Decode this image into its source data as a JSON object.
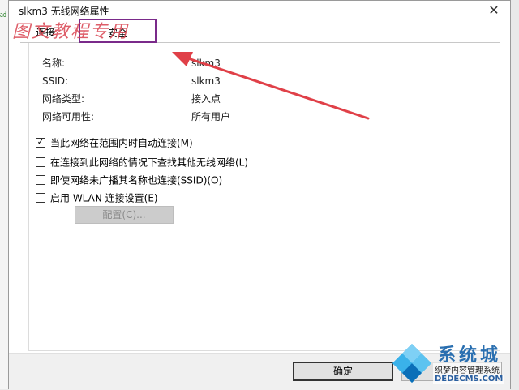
{
  "window": {
    "title": "slkm3 无线网络属性",
    "close_glyph": "✕"
  },
  "behind_window_fragment": "ad",
  "tabs": [
    {
      "label": "连接",
      "selected": false
    },
    {
      "label": "安全",
      "selected": true
    }
  ],
  "watermark_text": "图文教程专用",
  "properties": [
    {
      "label": "名称:",
      "value": "slkm3"
    },
    {
      "label": "SSID:",
      "value": "slkm3"
    },
    {
      "label": "网络类型:",
      "value": "接入点"
    },
    {
      "label": "网络可用性:",
      "value": "所有用户"
    }
  ],
  "options": [
    {
      "label": "当此网络在范围内时自动连接(M)",
      "checked": true
    },
    {
      "label": "在连接到此网络的情况下查找其他无线网络(L)",
      "checked": false
    },
    {
      "label": "即使网络未广播其名称也连接(SSID)(O)",
      "checked": false
    },
    {
      "label": "启用 WLAN 连接设置(E)",
      "checked": false
    }
  ],
  "config_button": {
    "label": "配置(C)...",
    "enabled": false
  },
  "footer": {
    "ok_label": "确定",
    "cancel_label": ""
  },
  "corner_logo": {
    "main": "系统城",
    "tagline": "织梦内容管理系统",
    "domain": "DEDECMS.COM"
  },
  "colors": {
    "highlight_box": "#7a2a8a",
    "arrow": "#e04048",
    "watermark": "#d9434f"
  }
}
